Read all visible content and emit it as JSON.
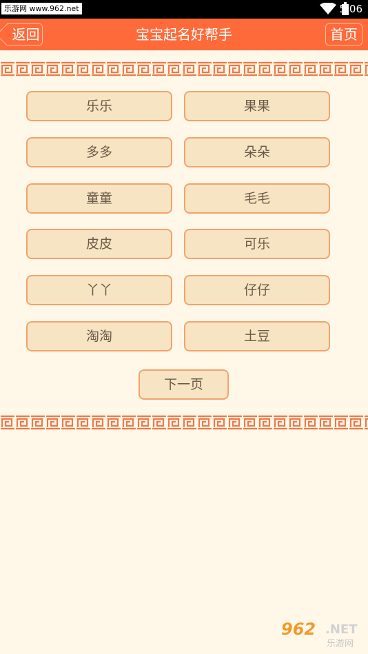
{
  "status_bar": {
    "watermark": "乐游网 www.962.net",
    "time": "5:06",
    "icons": [
      "wifi-icon",
      "battery-icon"
    ]
  },
  "header": {
    "back_label": "返回",
    "title": "宝宝起名好帮手",
    "home_label": "首页"
  },
  "names": [
    "乐乐",
    "果果",
    "多多",
    "朵朵",
    "童童",
    "毛毛",
    "皮皮",
    "可乐",
    "丫丫",
    "仔仔",
    "淘淘",
    "土豆"
  ],
  "pager": {
    "next_label": "下一页"
  },
  "footer_logo": {
    "brand": "962",
    "suffix": ".NET",
    "sub": "乐游网"
  },
  "colors": {
    "title_bar": "#ff6a3a",
    "background": "#fff8e8",
    "button_fill": "#f7e4c3",
    "button_border": "#f4a26c",
    "pattern": "#f0784a"
  }
}
